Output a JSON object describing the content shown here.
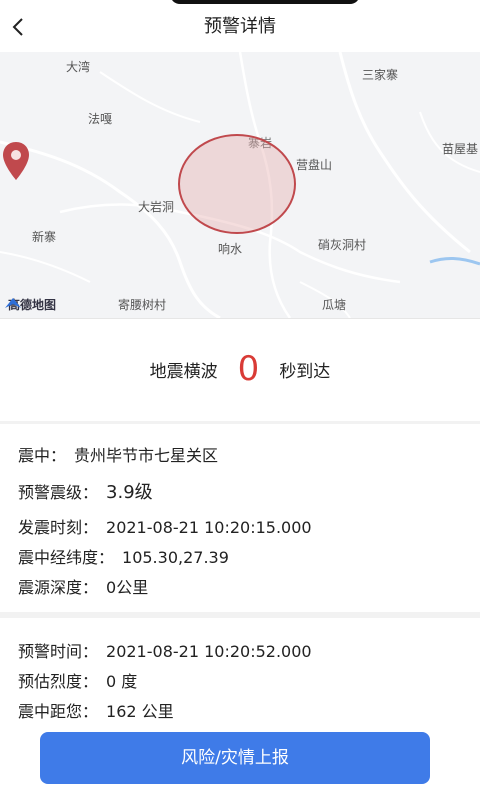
{
  "header": {
    "title": "预警详情"
  },
  "map": {
    "places": [
      "大湾",
      "三家寨",
      "法嘎",
      "营盘山",
      "苗屋基",
      "大岩洞",
      "新寨",
      "响水",
      "硝灰洞村",
      "寄腰树村",
      "瓜塘",
      "寨岩"
    ],
    "logo_text": "高德地图",
    "marker_color": "#c0494d"
  },
  "arrival": {
    "label_before": "地震横波",
    "seconds": "0",
    "label_after": "秒到达",
    "accent_color": "#d93b36"
  },
  "quake": {
    "epicenter_label": "震中：",
    "epicenter_value": "贵州毕节市七星关区",
    "magnitude_label": "预警震级：",
    "magnitude_value": "3.9级",
    "time_label": "发震时刻：",
    "time_value": "2021-08-21 10:20:15.000",
    "coords_label": "震中经纬度：",
    "coords_value": "105.30,27.39",
    "depth_label": "震源深度：",
    "depth_value": "0公里"
  },
  "warning": {
    "time_label": "预警时间：",
    "time_value": "2021-08-21 10:20:52.000",
    "intensity_label": "预估烈度：",
    "intensity_value": "0 度",
    "distance_label": "震中距您：",
    "distance_value": "162 公里"
  },
  "actions": {
    "report_label": "风险/灾情上报",
    "button_color": "#3f7be8"
  }
}
